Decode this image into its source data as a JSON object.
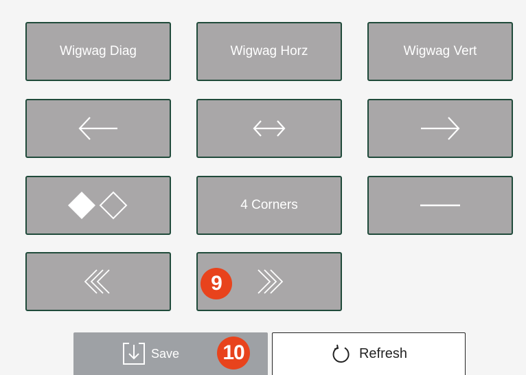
{
  "buttons": {
    "wigwag_diag": "Wigwag Diag",
    "wigwag_horz": "Wigwag Horz",
    "wigwag_vert": "Wigwag Vert",
    "four_corners": "4 Corners"
  },
  "icons": {
    "arrow_left": "arrow-left-icon",
    "arrow_both": "arrow-left-right-icon",
    "arrow_right": "arrow-right-icon",
    "diamonds": "filled-and-outline-diamond-icon",
    "dash": "horizontal-line-icon",
    "chevrons_left": "triple-chevron-left-icon",
    "chevrons_right": "triple-chevron-right-icon",
    "save": "save-arrow-down-icon",
    "refresh": "refresh-circular-arrow-icon"
  },
  "badges": {
    "chevrons_right": "9",
    "save": "10"
  },
  "footer": {
    "save_label": "Save",
    "refresh_label": "Refresh"
  },
  "colors": {
    "tile_bg": "#a9a7a8",
    "tile_border": "#1f4a3a",
    "badge": "#e8431c",
    "save_bg": "#9ea1a5"
  }
}
